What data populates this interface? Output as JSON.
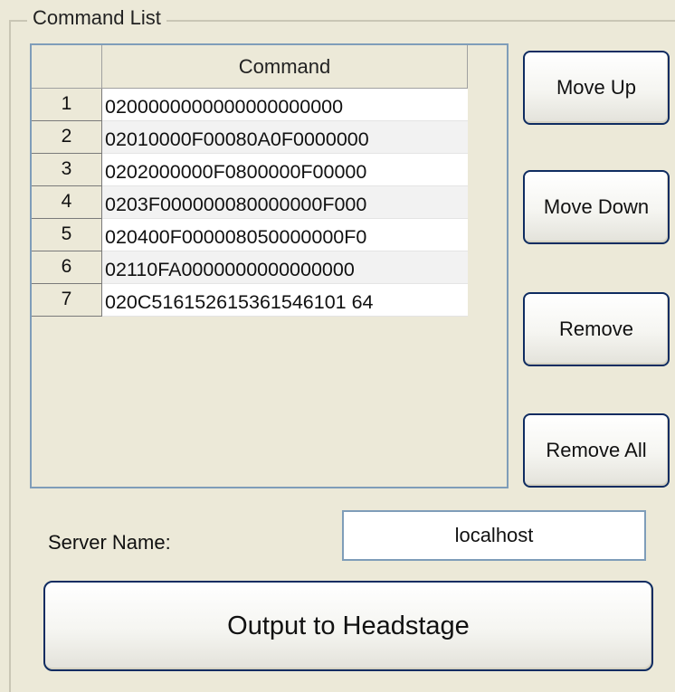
{
  "group": {
    "title": "Command List"
  },
  "grid": {
    "column_header": "Command",
    "rows": [
      {
        "num": "1",
        "command": "0200000000000000000000"
      },
      {
        "num": "2",
        "command": "02010000F00080A0F0000000"
      },
      {
        "num": "3",
        "command": "0202000000F0800000F00000"
      },
      {
        "num": "4",
        "command": "0203F000000080000000F000"
      },
      {
        "num": "5",
        "command": "020400F000008050000000F0"
      },
      {
        "num": "6",
        "command": "02110FA0000000000000000"
      },
      {
        "num": "7",
        "command": "020C516152615361546101 64"
      }
    ]
  },
  "buttons": {
    "move_up": "Move Up",
    "move_down": "Move Down",
    "remove": "Remove",
    "remove_all": "Remove All",
    "output": "Output to Headstage"
  },
  "server": {
    "label": "Server Name:",
    "value": "localhost"
  }
}
